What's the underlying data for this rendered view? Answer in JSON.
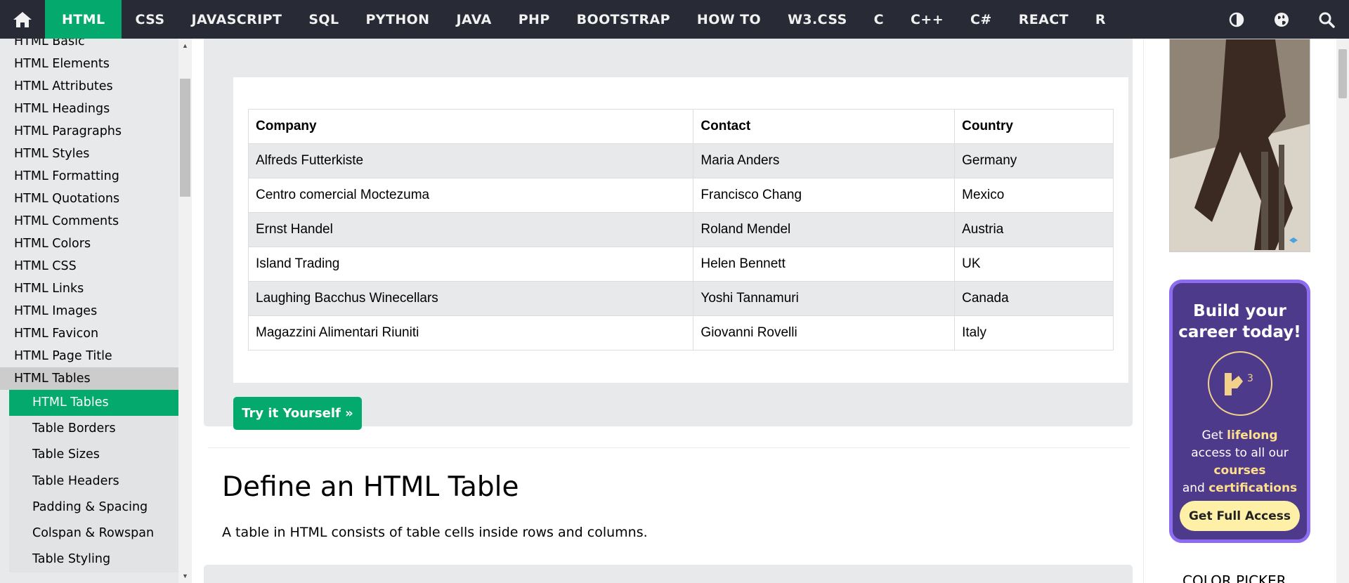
{
  "nav": {
    "home_icon": "home-icon",
    "items": [
      "HTML",
      "CSS",
      "JAVASCRIPT",
      "SQL",
      "PYTHON",
      "JAVA",
      "PHP",
      "BOOTSTRAP",
      "HOW TO",
      "W3.CSS",
      "C",
      "C++",
      "C#",
      "REACT",
      "R"
    ],
    "active": "HTML",
    "right_icons": [
      "contrast-icon",
      "globe-icon",
      "search-icon"
    ]
  },
  "sidebar": {
    "items": [
      "HTML Basic",
      "HTML Elements",
      "HTML Attributes",
      "HTML Headings",
      "HTML Paragraphs",
      "HTML Styles",
      "HTML Formatting",
      "HTML Quotations",
      "HTML Comments",
      "HTML Colors",
      "HTML CSS",
      "HTML Links",
      "HTML Images",
      "HTML Favicon",
      "HTML Page Title"
    ],
    "section": "HTML Tables",
    "subitems": [
      "HTML Tables",
      "Table Borders",
      "Table Sizes",
      "Table Headers",
      "Padding & Spacing",
      "Colspan & Rowspan",
      "Table Styling"
    ]
  },
  "table": {
    "headers": [
      "Company",
      "Contact",
      "Country"
    ],
    "rows": [
      [
        "Alfreds Futterkiste",
        "Maria Anders",
        "Germany"
      ],
      [
        "Centro comercial Moctezuma",
        "Francisco Chang",
        "Mexico"
      ],
      [
        "Ernst Handel",
        "Roland Mendel",
        "Austria"
      ],
      [
        "Island Trading",
        "Helen Bennett",
        "UK"
      ],
      [
        "Laughing Bacchus Winecellars",
        "Yoshi Tannamuri",
        "Canada"
      ],
      [
        "Magazzini Alimentari Riuniti",
        "Giovanni Rovelli",
        "Italy"
      ]
    ]
  },
  "try_button": "Try it Yourself »",
  "section": {
    "title": "Define an HTML Table",
    "text": "A table in HTML consists of table cells inside rows and columns."
  },
  "ad": {
    "headline_1": "Build your",
    "headline_2": "career today!",
    "line1_a": "Get ",
    "line1_b": "lifelong",
    "line2": "access to all our",
    "line3": "courses",
    "line4_a": "and ",
    "line4_b": "certifications",
    "cta": "Get Full Access"
  },
  "right": {
    "color_picker": "COLOR PICKER"
  },
  "colors": {
    "nav_bg": "#282A35",
    "accent": "#04AA6D",
    "panel": "#E7E9EB",
    "ad_bg": "#4E3A8A"
  }
}
